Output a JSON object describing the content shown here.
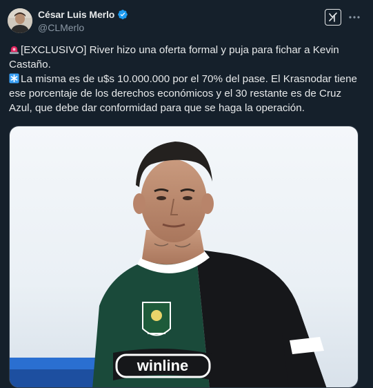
{
  "author": {
    "display_name": "César Luis Merlo",
    "handle": "@CLMerlo",
    "verified": true,
    "avatar_icon": "avatar-photo"
  },
  "header_actions": {
    "grok_icon": "grok-icon",
    "more_icon": "more-dots-icon"
  },
  "post": {
    "line1_emoji": "rotating-light-emoji",
    "line1": "[EXCLUSIVO] River hizo una oferta formal y puja para fichar a Kevin Castaño.",
    "line2_emoji": "asterisk-emoji",
    "line2": "La misma es de u$s 10.000.000 por el 70% del pase. El Krasnodar tiene ese porcentaje de los derechos económicos y el 30 restante es de Cruz Azul, que debe dar conformidad para que se haga la operación."
  },
  "media": {
    "jersey_sponsor": "winline",
    "badge_icon": "fc-krasnodar-crest-icon"
  },
  "colors": {
    "background": "#15202b",
    "text_primary": "#e7e9ea",
    "text_secondary": "#8b98a5",
    "verified_blue": "#1d9bf0",
    "emoji_red": "#e0245e",
    "emoji_blue": "#3aa0f5"
  }
}
